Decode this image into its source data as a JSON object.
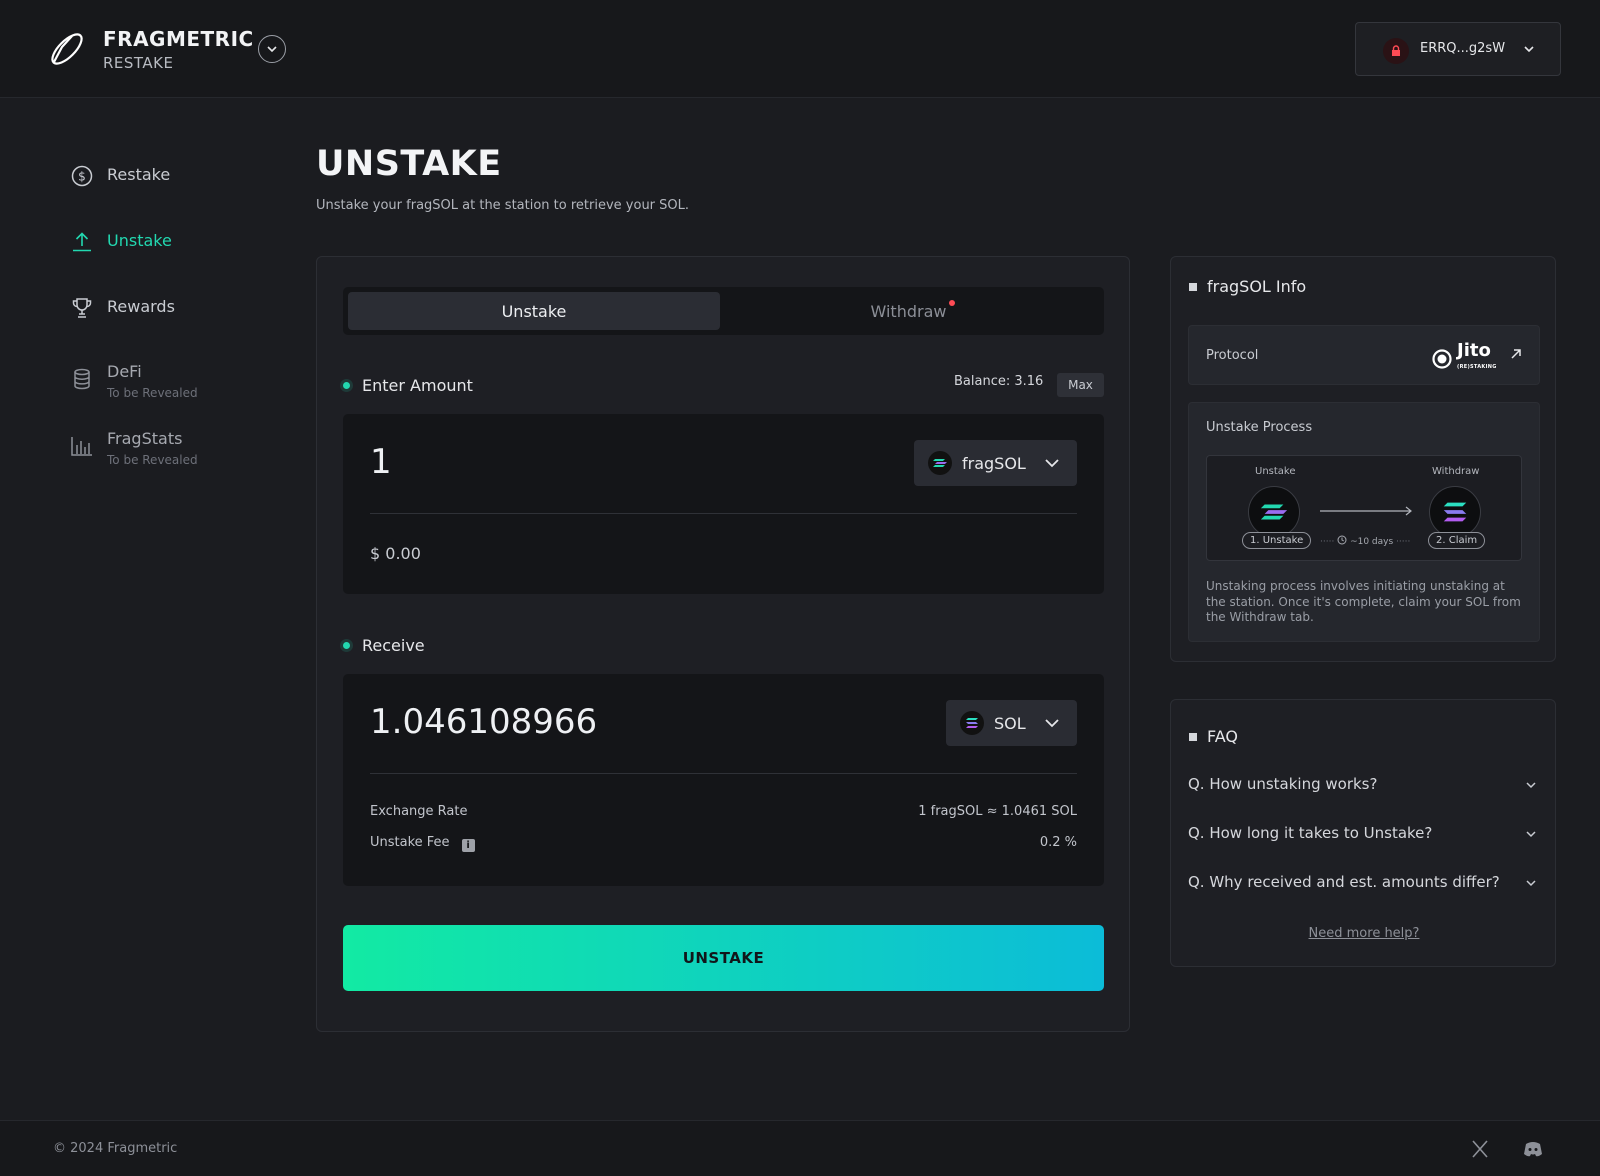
{
  "brand": {
    "name": "FRAGMETRIC",
    "sub": "RESTAKE"
  },
  "wallet": {
    "address": "ERRQ...g2sW"
  },
  "sidebar": {
    "items": [
      {
        "label": "Restake",
        "sub": ""
      },
      {
        "label": "Unstake",
        "sub": ""
      },
      {
        "label": "Rewards",
        "sub": ""
      },
      {
        "label": "DeFi",
        "sub": "To be Revealed"
      },
      {
        "label": "FragStats",
        "sub": "To be Revealed"
      }
    ]
  },
  "page": {
    "title": "UNSTAKE",
    "subtitle": "Unstake your fragSOL at the station to retrieve your SOL."
  },
  "main": {
    "tabs": [
      {
        "label": "Unstake",
        "active": true
      },
      {
        "label": "Withdraw",
        "active": false
      }
    ],
    "enter_amount": {
      "label": "Enter Amount",
      "balance_label": "Balance:",
      "balance_value": "3.16",
      "max_label": "Max",
      "value": "1",
      "token": "fragSOL",
      "usd": "$ 0.00"
    },
    "receive": {
      "label": "Receive",
      "value": "1.046108966",
      "token": "SOL",
      "exchange_rate_label": "Exchange Rate",
      "exchange_rate_value": "1 fragSOL ≈ 1.0461 SOL",
      "fee_label": "Unstake Fee",
      "fee_value": "0.2 %"
    },
    "cta_label": "UNSTAKE"
  },
  "info": {
    "title": "fragSOL Info",
    "protocol_label": "Protocol",
    "protocol_name": "Jito",
    "protocol_sub": "(RE)STAKING",
    "process_title": "Unstake Process",
    "flow": {
      "left_caption": "Unstake",
      "right_caption": "Withdraw",
      "left_pill": "1. Unstake",
      "right_pill": "2. Claim",
      "duration": "~10 days"
    },
    "process_desc": "Unstaking process involves initiating unstaking at the station. Once it's complete, claim your SOL from the Withdraw tab."
  },
  "faq": {
    "title": "FAQ",
    "items": [
      "Q. How unstaking works?",
      "Q. How long it takes to Unstake?",
      "Q. Why received and est. amounts differ?"
    ],
    "help_link": "Need more help?"
  },
  "footer": {
    "copyright": "© 2024 Fragmetric"
  },
  "colors": {
    "accent": "#22d8b0",
    "cta_start": "#12eaa3",
    "cta_end": "#0cbcd8",
    "alert_dot": "#ff4b55"
  }
}
